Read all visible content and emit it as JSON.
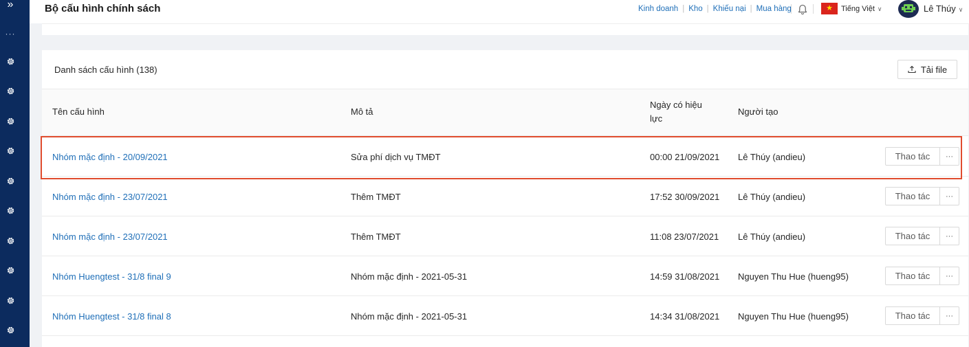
{
  "sidebar": {
    "expand_glyph": "»",
    "more_glyph": "···",
    "item_count": 10
  },
  "header": {
    "title": "Bộ cấu hình chính sách",
    "links": [
      "Kinh doanh",
      "Kho",
      "Khiếu nại",
      "Mua hàng"
    ],
    "language": "Tiếng Việt",
    "user_name": "Lê Thúy"
  },
  "list": {
    "title": "Danh sách cấu hình (138)",
    "download_label": "Tải file",
    "columns": {
      "name": "Tên cấu hình",
      "description": "Mô tả",
      "effective_date_line1": "Ngày có hiệu",
      "effective_date_line2": "lực",
      "creator": "Người tạo"
    },
    "action_label": "Thao tác",
    "more_label": "···",
    "rows": [
      {
        "name": "Nhóm mặc định - 20/09/2021",
        "description": "Sửa phí dịch vụ TMĐT",
        "effective_date": "00:00 21/09/2021",
        "creator": "Lê Thúy (andieu)"
      },
      {
        "name": "Nhóm mặc định - 23/07/2021",
        "description": "Thêm TMĐT",
        "effective_date": "17:52 30/09/2021",
        "creator": "Lê Thúy (andieu)"
      },
      {
        "name": "Nhóm mặc định - 23/07/2021",
        "description": "Thêm TMĐT",
        "effective_date": "11:08 23/07/2021",
        "creator": "Lê Thúy (andieu)"
      },
      {
        "name": "Nhóm Huengtest - 31/8 final 9",
        "description": "Nhóm mặc định - 2021-05-31",
        "effective_date": "14:59 31/08/2021",
        "creator": "Nguyen Thu Hue (hueng95)"
      },
      {
        "name": "Nhóm Huengtest - 31/8 final 8",
        "description": "Nhóm mặc định - 2021-05-31",
        "effective_date": "14:34 31/08/2021",
        "creator": "Nguyen Thu Hue (hueng95)"
      }
    ]
  },
  "colors": {
    "sidebar_bg": "#0c2b5e",
    "link": "#1f6fb8",
    "highlight": "#e04c2e"
  }
}
